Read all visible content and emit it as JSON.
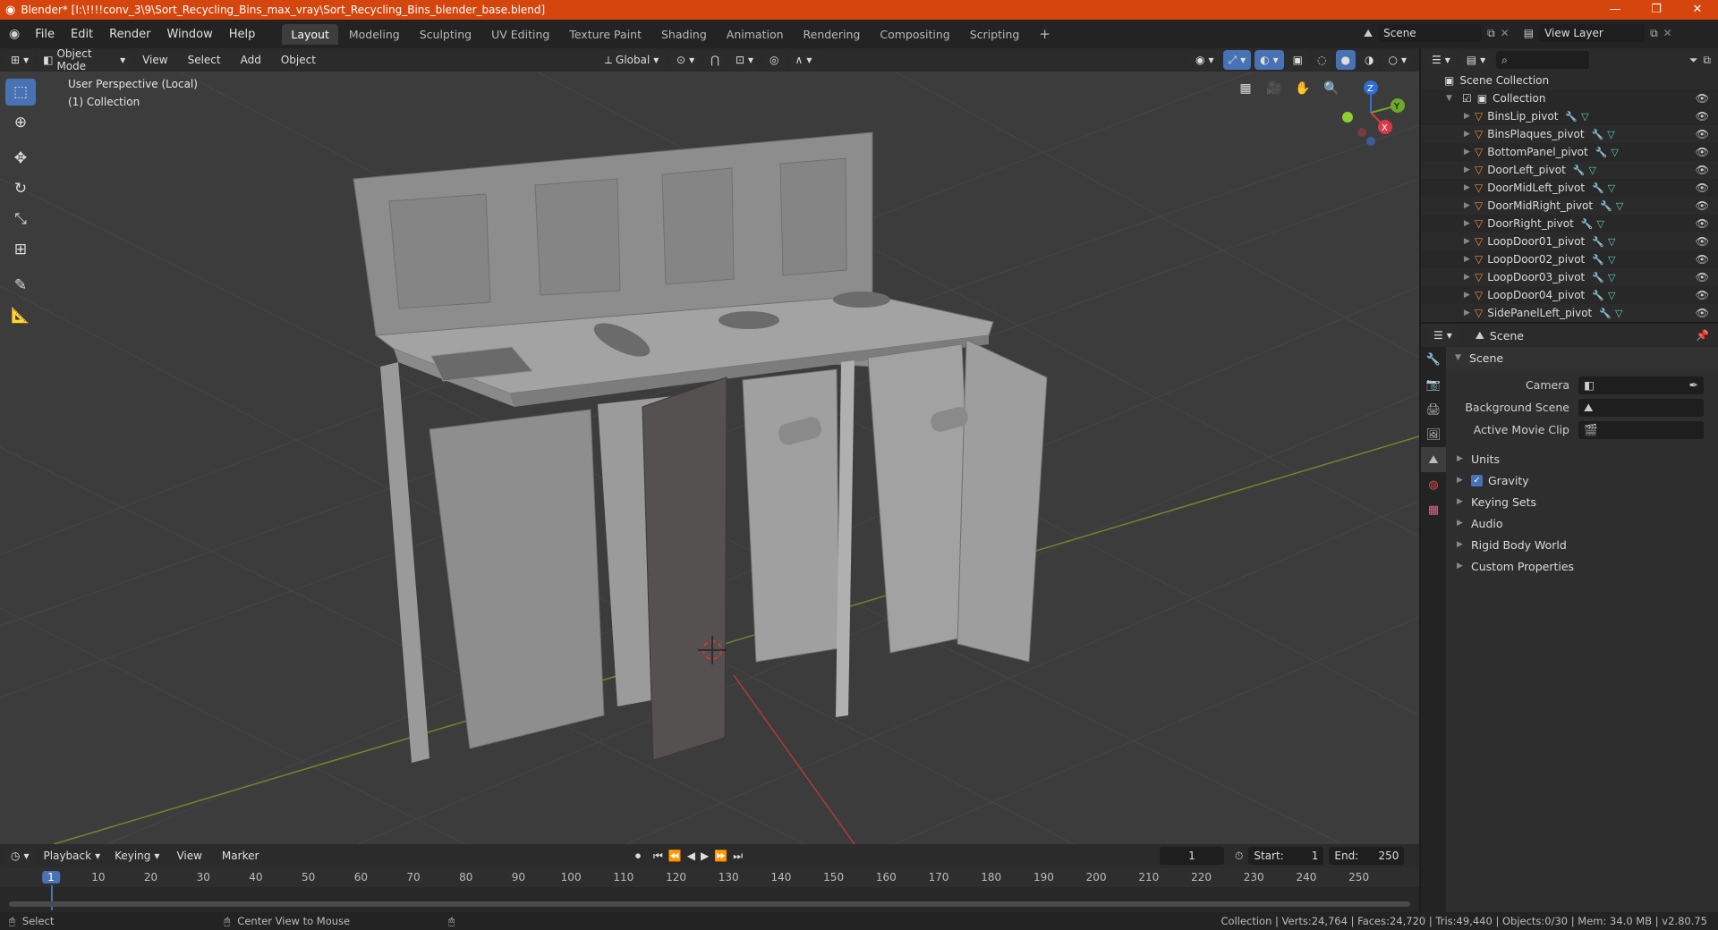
{
  "window": {
    "title": "Blender* [I:\\!!!!conv_3\\9\\Sort_Recycling_Bins_max_vray\\Sort_Recycling_Bins_blender_base.blend]",
    "minimize": "—",
    "maximize": "❐",
    "close": "✕"
  },
  "menubar": {
    "items": [
      "File",
      "Edit",
      "Render",
      "Window",
      "Help"
    ],
    "workspaces": [
      "Layout",
      "Modeling",
      "Sculpting",
      "UV Editing",
      "Texture Paint",
      "Shading",
      "Animation",
      "Rendering",
      "Compositing",
      "Scripting"
    ],
    "add_ws": "+",
    "scene_label": "Scene",
    "view_layer_label": "View Layer"
  },
  "viewport_header": {
    "mode": "Object Mode",
    "view": "View",
    "select": "Select",
    "add": "Add",
    "object": "Object",
    "transform_orientation": "Global"
  },
  "viewport": {
    "perspective": "User Perspective (Local)",
    "collection": "(1) Collection",
    "gizmo": {
      "z": "Z",
      "y": "Y",
      "x": "X"
    }
  },
  "outliner": {
    "root": "Scene Collection",
    "collection": "Collection",
    "items": [
      "BinsLip_pivot",
      "BinsPlaques_pivot",
      "BottomPanel_pivot",
      "DoorLeft_pivot",
      "DoorMidLeft_pivot",
      "DoorMidRight_pivot",
      "DoorRight_pivot",
      "LoopDoor01_pivot",
      "LoopDoor02_pivot",
      "LoopDoor03_pivot",
      "LoopDoor04_pivot",
      "SidePanelLeft_pivot"
    ]
  },
  "properties": {
    "header": "Scene",
    "panel": "Scene",
    "camera_label": "Camera",
    "background_scene_label": "Background Scene",
    "active_movie_clip_label": "Active Movie Clip",
    "subpanels": [
      "Units",
      "Gravity",
      "Keying Sets",
      "Audio",
      "Rigid Body World",
      "Custom Properties"
    ]
  },
  "timeline": {
    "playback": "Playback",
    "keying": "Keying",
    "view": "View",
    "marker": "Marker",
    "current_frame": "1",
    "start_label": "Start:",
    "start": "1",
    "end_label": "End:",
    "end": "250",
    "frames": [
      "1",
      "10",
      "20",
      "30",
      "40",
      "50",
      "60",
      "70",
      "80",
      "90",
      "100",
      "110",
      "120",
      "130",
      "140",
      "150",
      "160",
      "170",
      "180",
      "190",
      "200",
      "210",
      "220",
      "230",
      "240",
      "250"
    ]
  },
  "statusbar": {
    "select": "Select",
    "center_view": "Center View to Mouse",
    "stats": "Collection | Verts:24,764 | Faces:24,720 | Tris:49,440 | Objects:0/30 | Mem: 34.0 MB | v2.80.75"
  }
}
